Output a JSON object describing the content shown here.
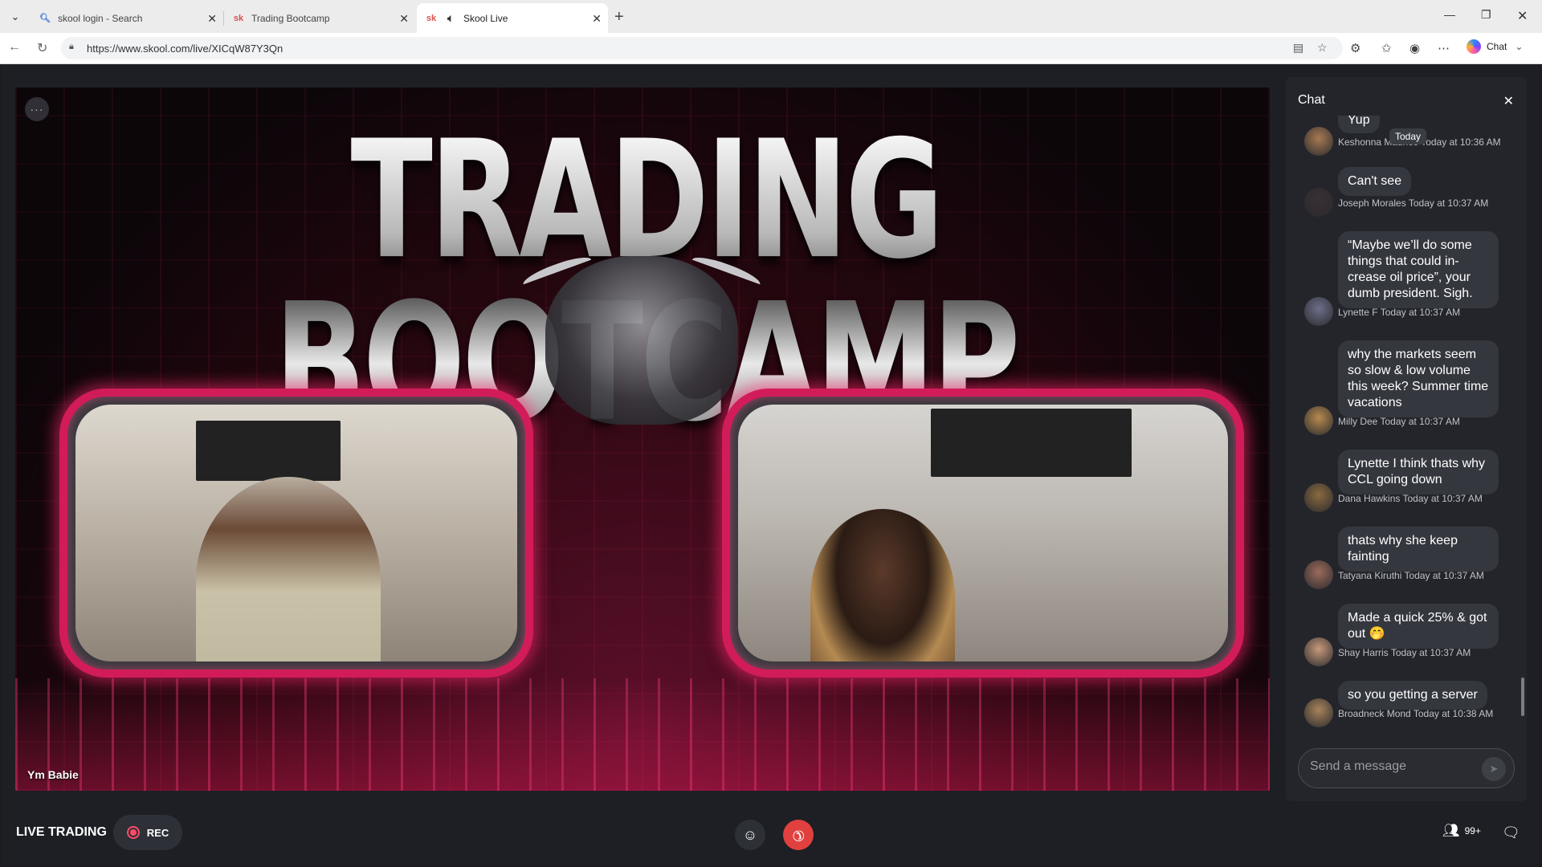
{
  "browser": {
    "tabs": [
      {
        "title": "skool login - Search",
        "favicon": "search-icon"
      },
      {
        "title": "Trading Bootcamp",
        "favicon": "sk"
      },
      {
        "title": "Skool Live",
        "favicon": "sk",
        "audio": true
      }
    ],
    "url": "https://www.skool.com/live/XICqW87Y3Qn",
    "copilot_label": "Chat"
  },
  "stage": {
    "banner_text": "TRADING BOOTCAMP",
    "speaker_name": "Ym Babie"
  },
  "chat": {
    "title": "Chat",
    "today_pill": "Today",
    "messages": [
      {
        "text": "Yup",
        "author": "Keshonna Maurice",
        "time": "Today at 10:36 AM",
        "avatar_color": "#a87a52"
      },
      {
        "text": "Can't see",
        "author": "Joseph Morales",
        "time": "Today at 10:37 AM",
        "avatar_color": "#3a2f33"
      },
      {
        "text": "“Maybe we’ll do some things that could in-crease oil price”, your dumb president. Sigh.",
        "author": "Lynette F",
        "time": "Today at 10:37 AM",
        "avatar_color": "#6d6f8a"
      },
      {
        "text": "why the markets seem so slow & low volume this week? Summer time vacations",
        "author": "Milly Dee",
        "time": "Today at 10:37 AM",
        "avatar_color": "#b88a4e"
      },
      {
        "text": "Lynette I think thats why CCL going down",
        "author": "Dana Hawkins",
        "time": "Today at 10:37 AM",
        "avatar_color": "#8b6a3f"
      },
      {
        "text": "thats why she keep fainting",
        "author": "Tatyana Kiruthi",
        "time": "Today at 10:37 AM",
        "avatar_color": "#9b6b5a"
      },
      {
        "text": "Made a quick 25% & got out 🤭",
        "author": "Shay Harris",
        "time": "Today at 10:37 AM",
        "avatar_color": "#c79a7a"
      },
      {
        "text": "so you getting a server",
        "author": "Broadneck Mond",
        "time": "Today at 10:38 AM",
        "avatar_color": "#a8845a"
      }
    ],
    "input_placeholder": "Send a message"
  },
  "controls": {
    "live_label": "LIVE TRADING",
    "rec_label": "REC",
    "member_count": "99+"
  }
}
